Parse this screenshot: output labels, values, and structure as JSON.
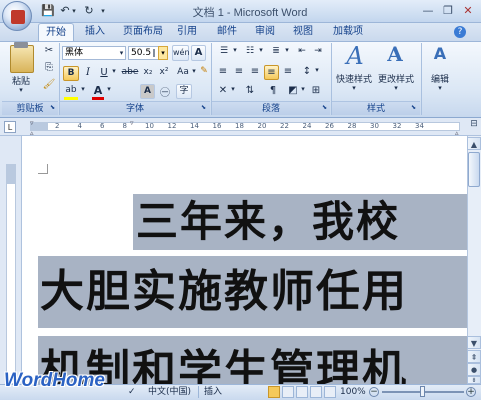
{
  "window": {
    "title": "文档 1 - Microsoft Word"
  },
  "tabs": [
    "开始",
    "插入",
    "页面布局",
    "引用",
    "邮件",
    "审阅",
    "视图",
    "加载项"
  ],
  "ribbon": {
    "clipboard": {
      "paste_label": "粘贴",
      "group_label": "剪贴板"
    },
    "font": {
      "font_name": "黑体",
      "font_size": "50.5",
      "size_cursor": "I",
      "phonetic": "wén",
      "border_char": "A",
      "bold": "B",
      "italic": "I",
      "underline": "U",
      "strike": "abe",
      "subscript": "x₂",
      "superscript": "x²",
      "change_case": "Aa",
      "highlight": "ab",
      "font_color": "A",
      "shade": "A",
      "enclose": "字",
      "group_label": "字体"
    },
    "paragraph": {
      "group_label": "段落"
    },
    "styles": {
      "quick_style_label": "快速样式",
      "change_style_label": "更改样式",
      "group_label": "样式"
    },
    "editing": {
      "edit_label": "编辑"
    }
  },
  "ruler": {
    "ticks": [
      "2",
      "4",
      "6",
      "8",
      "10",
      "12",
      "14",
      "16",
      "18",
      "20",
      "22",
      "24",
      "26",
      "28",
      "30",
      "32",
      "34"
    ]
  },
  "document": {
    "lines": [
      "三年来，我校",
      "大胆实施教师任用",
      "机制和学生管理机"
    ]
  },
  "status": {
    "language": "中文(中国)",
    "mode": "插入",
    "zoom": "100%"
  },
  "watermark": "WordHome"
}
